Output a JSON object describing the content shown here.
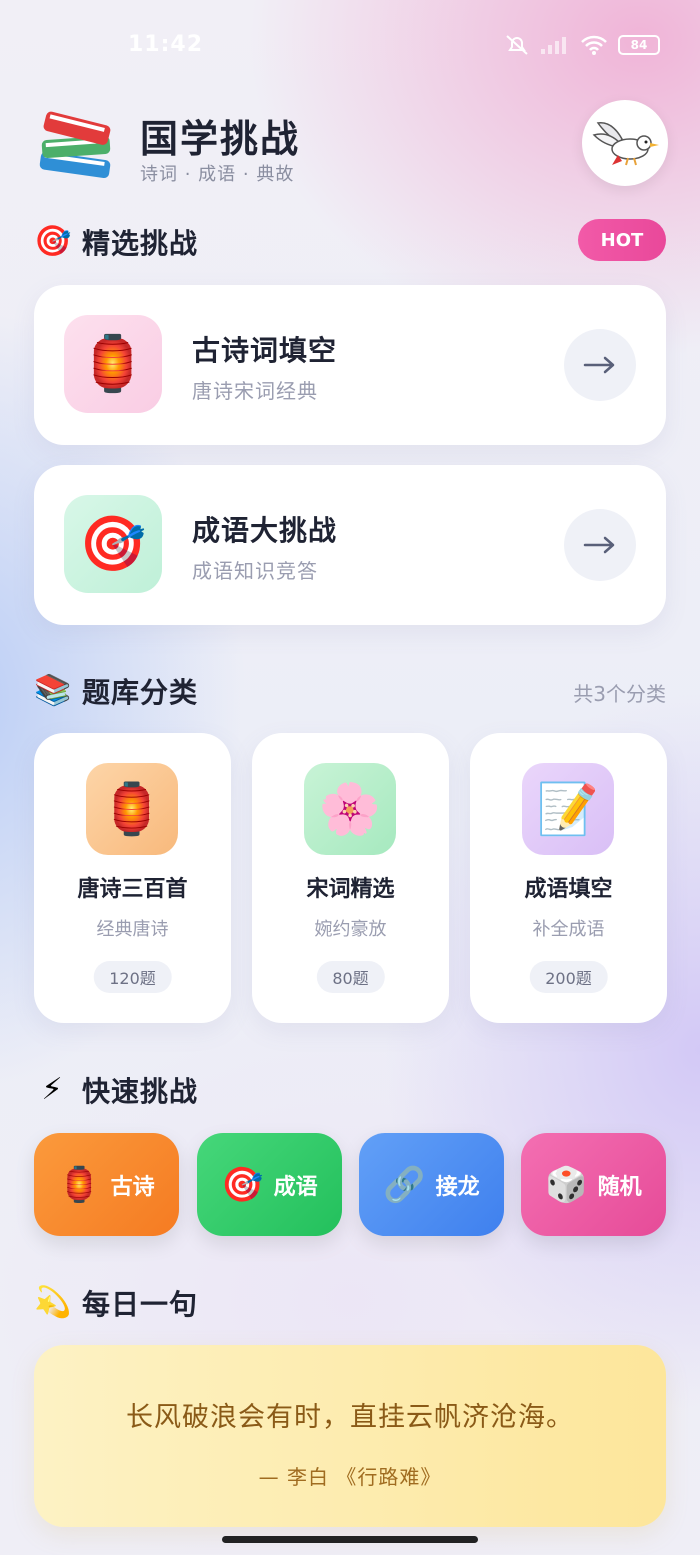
{
  "status_bar": {
    "time": "11:42",
    "battery": "84"
  },
  "header": {
    "title": "国学挑战",
    "subtitle": "诗词 · 成语 · 典故"
  },
  "featured": {
    "section_title": "精选挑战",
    "badge": "HOT",
    "items": [
      {
        "title": "古诗词填空",
        "subtitle": "唐诗宋词经典",
        "icon": "lantern-icon",
        "emoji": "🏮"
      },
      {
        "title": "成语大挑战",
        "subtitle": "成语知识竞答",
        "icon": "target-icon",
        "emoji": "🎯"
      }
    ]
  },
  "categories": {
    "section_title": "题库分类",
    "count_label": "共3个分类",
    "items": [
      {
        "title": "唐诗三百首",
        "subtitle": "经典唐诗",
        "count": "120题",
        "icon": "lantern-icon",
        "emoji": "🏮"
      },
      {
        "title": "宋词精选",
        "subtitle": "婉约豪放",
        "count": "80题",
        "icon": "flower-icon",
        "emoji": "🌸"
      },
      {
        "title": "成语填空",
        "subtitle": "补全成语",
        "count": "200题",
        "icon": "memo-icon",
        "emoji": "📝"
      }
    ]
  },
  "quick": {
    "section_title": "快速挑战",
    "items": [
      {
        "label": "古诗",
        "icon": "lantern-icon",
        "emoji": "🏮",
        "color": "#f58a2e"
      },
      {
        "label": "成语",
        "icon": "target-icon",
        "emoji": "🎯",
        "color": "#34c969"
      },
      {
        "label": "接龙",
        "icon": "link-icon",
        "emoji": "🔗",
        "color": "#4f8ff2"
      },
      {
        "label": "随机",
        "icon": "dice-icon",
        "emoji": "🎲",
        "color": "#ee5aa6"
      }
    ]
  },
  "daily": {
    "section_title": "每日一句",
    "quote": "长风破浪会有时，直挂云帆济沧海。",
    "author": "— 李白 《行路难》"
  },
  "section_emojis": {
    "featured": "🎯",
    "categories": "📚",
    "quick": "⚡",
    "daily": "💫"
  },
  "colors": {
    "accent_pink": "#e9489a",
    "title": "#1f2333",
    "muted": "#9a9db0"
  }
}
